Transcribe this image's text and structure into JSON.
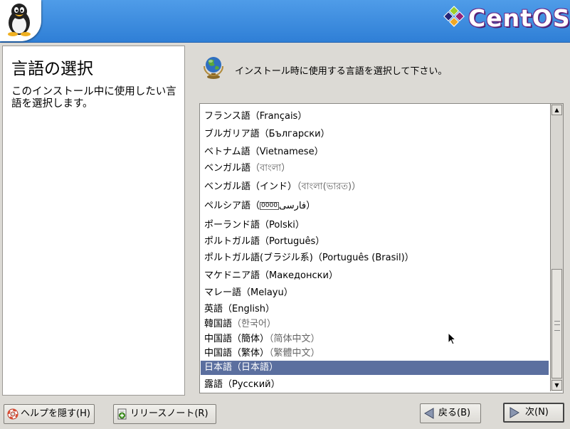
{
  "header": {
    "logo_text": "CentOS"
  },
  "help": {
    "title": "言語の選択",
    "body": "このインストール中に使用したい言語を選択します。"
  },
  "main": {
    "instruction": "インストール時に使用する言語を選択して下さい。"
  },
  "languages": [
    {
      "name": "フランス語",
      "native": "（Français）"
    },
    {
      "name": "ブルガリア語",
      "native": "（Български）"
    },
    {
      "name": "ベトナム語",
      "native": "（Vietnamese）"
    },
    {
      "name": "ベンガル語",
      "native": "（বাংলা）"
    },
    {
      "name": "ベンガル語（インド）",
      "native": "（বাংলা(ভারত)）"
    },
    {
      "name": "ペルシア語",
      "native_pre": "（",
      "native_box": "0000",
      "native_post": "فارسی）"
    },
    {
      "name": "ポーランド語",
      "native": "（Polski）"
    },
    {
      "name": "ポルトガル語",
      "native": "（Português）"
    },
    {
      "name": "ポルトガル語(ブラジル系)",
      "native": "（Português (Brasil)）"
    },
    {
      "name": "マケドニア語",
      "native": "（Македонски）"
    },
    {
      "name": "マレー語",
      "native": "（Melayu）"
    },
    {
      "name": "英語",
      "native": "（English）"
    },
    {
      "name": "韓国語",
      "native": "（한국어）"
    },
    {
      "name": "中国語（簡体）",
      "native": "（简体中文）"
    },
    {
      "name": "中国語（繁体）",
      "native": "（繁體中文）"
    },
    {
      "name": "日本語",
      "native": "（日本語）",
      "selected": true
    },
    {
      "name": "露語",
      "native": "（Русский）"
    }
  ],
  "buttons": {
    "hide_help": "ヘルプを隠す(H)",
    "release_notes": "リリースノート(R)",
    "back": "戻る(B)",
    "next": "次(N)"
  },
  "colors": {
    "header_blue": "#3a88dc",
    "selection": "#5b6f9f",
    "background": "#dcdad5"
  },
  "icons": {
    "header": "tux-penguin-icon",
    "logo": "centos-logo-icon",
    "instruction": "globe-icon",
    "hide_help": "lifebuoy-icon",
    "release_notes": "document-plus-icon",
    "back": "left-arrow-icon",
    "next": "right-arrow-icon"
  }
}
